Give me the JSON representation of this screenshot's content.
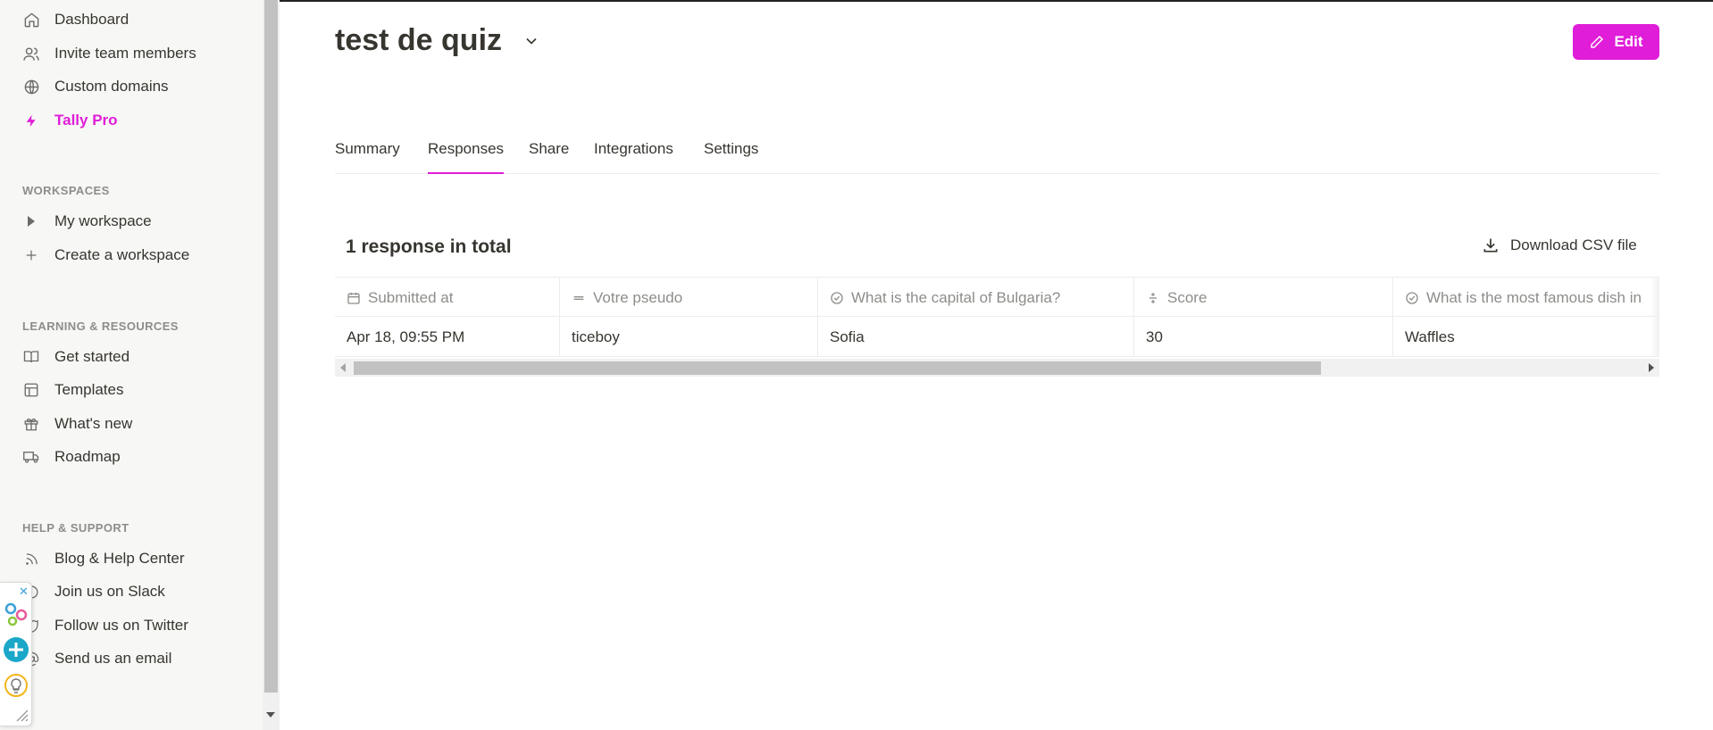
{
  "colors": {
    "accent": "#e01dd8",
    "text": "#37352f",
    "muted": "#8d8d8a",
    "sidebar_bg": "#f7f7f5"
  },
  "sidebar": {
    "top_items": [
      {
        "label": "Dashboard",
        "icon": "home-icon"
      },
      {
        "label": "Invite team members",
        "icon": "users-icon"
      },
      {
        "label": "Custom domains",
        "icon": "globe-icon"
      },
      {
        "label": "Tally Pro",
        "icon": "lightning-icon"
      }
    ],
    "workspaces": {
      "title": "WORKSPACES",
      "items": [
        {
          "label": "My workspace",
          "icon": "caret-right-icon"
        },
        {
          "label": "Create a workspace",
          "icon": "plus-icon"
        }
      ]
    },
    "learning": {
      "title": "LEARNING & RESOURCES",
      "items": [
        {
          "label": "Get started",
          "icon": "book-icon"
        },
        {
          "label": "Templates",
          "icon": "layout-icon"
        },
        {
          "label": "What's new",
          "icon": "gift-icon"
        },
        {
          "label": "Roadmap",
          "icon": "truck-icon"
        }
      ]
    },
    "help": {
      "title": "HELP & SUPPORT",
      "items": [
        {
          "label": "Blog & Help Center",
          "icon": "rss-icon"
        },
        {
          "label": "Join us on Slack",
          "icon": "slack-icon"
        },
        {
          "label": "Follow us on Twitter",
          "icon": "twitter-icon"
        },
        {
          "label": "Send us an email",
          "icon": "at-icon"
        }
      ]
    }
  },
  "header": {
    "title": "test de quiz",
    "edit_label": "Edit"
  },
  "tabs": [
    {
      "label": "Summary",
      "active": false
    },
    {
      "label": "Responses",
      "active": true
    },
    {
      "label": "Share",
      "active": false
    },
    {
      "label": "Integrations",
      "active": false
    },
    {
      "label": "Settings",
      "active": false
    }
  ],
  "responses": {
    "total_label": "1 response in total",
    "download_label": "Download CSV file",
    "columns": [
      {
        "label": "Submitted at",
        "icon": "calendar-icon"
      },
      {
        "label": "Votre pseudo",
        "icon": "short-text-icon"
      },
      {
        "label": "What is the capital of Bulgaria?",
        "icon": "check-circle-icon"
      },
      {
        "label": "Score",
        "icon": "calculator-icon"
      },
      {
        "label": "What is the most famous dish in",
        "icon": "check-circle-icon"
      }
    ],
    "rows": [
      [
        "Apr 18, 09:55 PM",
        "ticeboy",
        "Sofia",
        "30",
        "Waffles"
      ]
    ]
  }
}
